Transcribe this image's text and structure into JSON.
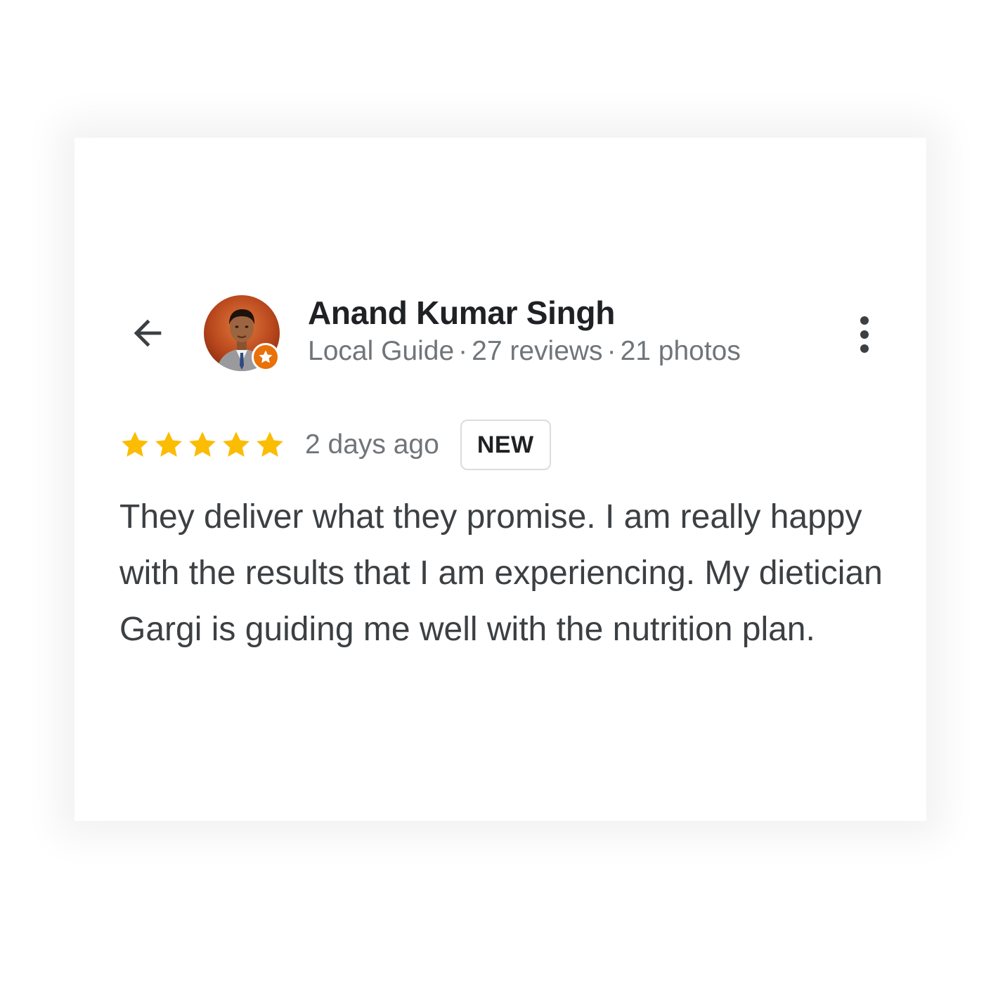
{
  "review": {
    "reviewer": {
      "name": "Anand Kumar Singh",
      "level": "Local Guide",
      "separator": "·",
      "reviews": "27 reviews",
      "photos": "21 photos",
      "badge_color": "#e8710a",
      "avatar_icon": "person-avatar"
    },
    "rating": 5,
    "rating_max": 5,
    "star_color": "#fbbc04",
    "time_ago": "2 days ago",
    "badge": "NEW",
    "text": "They deliver what they promise. I am really happy with the results that I am experiencing. My dietician Gargi is guiding me well with the nutrition plan."
  },
  "icons": {
    "back": "arrow-back-icon",
    "more": "more-vert-icon",
    "guide_badge": "star-badge-icon",
    "star": "star-icon"
  }
}
